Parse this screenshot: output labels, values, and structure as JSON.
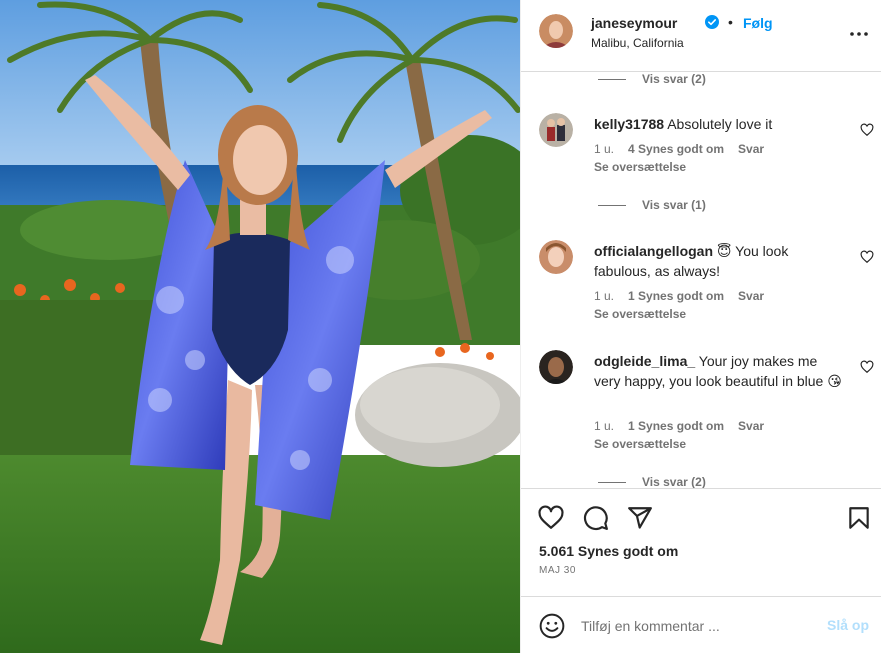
{
  "post": {
    "username": "janeseymour",
    "separator": "•",
    "follow_label": "Følg",
    "location": "Malibu, California",
    "verified": true
  },
  "comments": {
    "replies_top": "Vis svar (2)",
    "items": [
      {
        "username": "kelly31788",
        "text": "Absolutely love it",
        "time": "1 u.",
        "likes": "4 Synes godt om",
        "reply": "Svar",
        "translate": "Se oversættelse",
        "view_replies": "Vis svar (1)"
      },
      {
        "username": "officialangellogan",
        "text": "😇 You look fabulous, as always!",
        "time": "1 u.",
        "likes": "1 Synes godt om",
        "reply": "Svar",
        "translate": "Se oversættelse"
      },
      {
        "username": "odgleide_lima_",
        "text": "Your joy makes me very happy, you look beautiful in blue 😘",
        "time": "1 u.",
        "likes": "1 Synes godt om",
        "reply": "Svar",
        "translate": "Se oversættelse",
        "view_replies": "Vis svar (2)"
      }
    ]
  },
  "actions": {
    "icons": [
      "heart-icon",
      "comment-icon",
      "share-icon",
      "bookmark-icon"
    ],
    "likes": "5.061 Synes godt om",
    "date": "MAJ 30"
  },
  "add_comment": {
    "placeholder": "Tilføj en kommentar ...",
    "post_label": "Slå op"
  },
  "colors": {
    "accent": "#0095f6",
    "post_disabled": "#b2dffc",
    "secondary_text": "#737373",
    "divider": "#dbdbdb"
  }
}
